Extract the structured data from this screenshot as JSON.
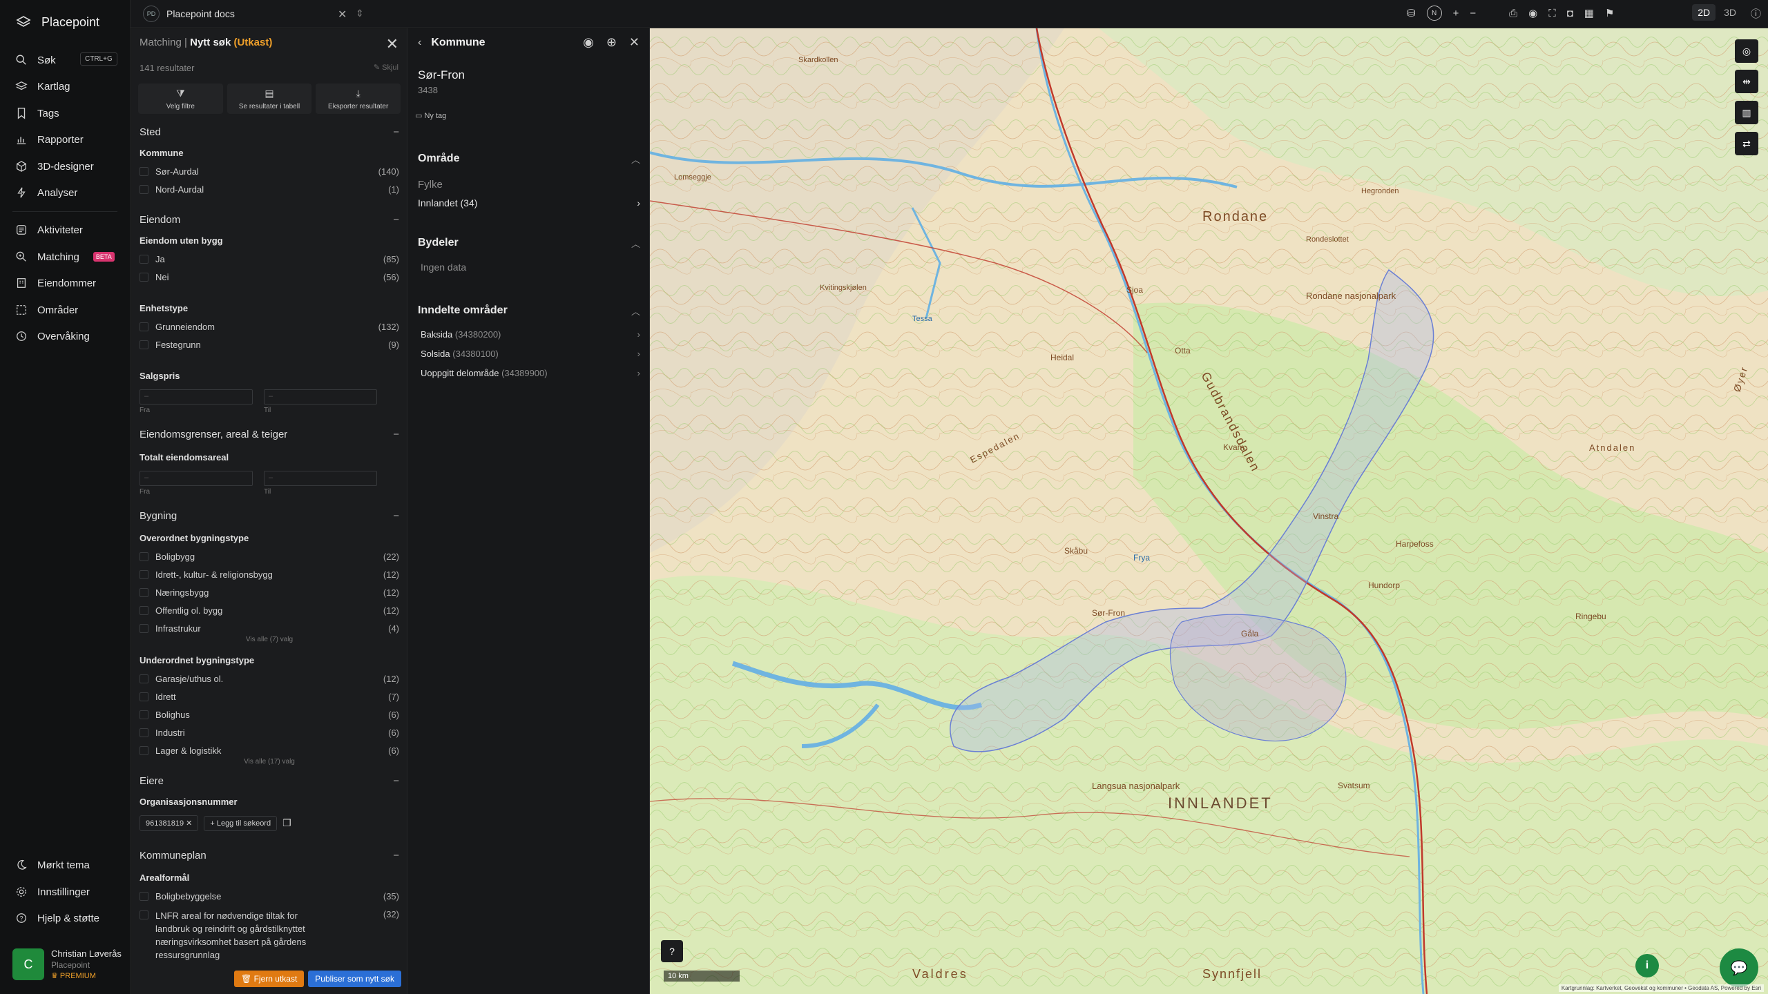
{
  "app": {
    "name": "Placepoint"
  },
  "sidebar": {
    "items": [
      {
        "label": "Søk",
        "icon": "search-icon"
      },
      {
        "label": "Kartlag",
        "icon": "layers-icon"
      },
      {
        "label": "Tags",
        "icon": "bookmark-icon"
      },
      {
        "label": "Rapporter",
        "icon": "chart-icon"
      },
      {
        "label": "3D-designer",
        "icon": "cube-icon"
      },
      {
        "label": "Analyser",
        "icon": "bolt-icon"
      },
      {
        "label": "Aktiviteter",
        "icon": "activity-icon"
      },
      {
        "label": "Matching",
        "icon": "matching-icon",
        "badge": "BETA"
      },
      {
        "label": "Eiendommer",
        "icon": "building-icon"
      },
      {
        "label": "Områder",
        "icon": "area-icon"
      },
      {
        "label": "Overvåking",
        "icon": "clock-icon"
      }
    ],
    "shortcut": "CTRL+G",
    "bottom_items": [
      {
        "label": "Mørkt tema",
        "icon": "moon-icon"
      },
      {
        "label": "Innstillinger",
        "icon": "gear-icon"
      },
      {
        "label": "Hjelp & støtte",
        "icon": "help-icon"
      }
    ],
    "user": {
      "initial": "C",
      "name": "Christian Løverås",
      "company": "Placepoint",
      "plan": "PREMIUM"
    }
  },
  "topbar": {
    "doc_badge": "PD",
    "doc_title": "Placepoint docs",
    "view_2d": "2D",
    "view_3d": "3D"
  },
  "matching": {
    "breadcrumb": "Matching",
    "title": "Nytt søk",
    "status": "(Utkast)",
    "results": "141 resultater",
    "hide": "Skjul",
    "actions": [
      "Velg filtre",
      "Se resultater i tabell",
      "Eksporter resultater"
    ],
    "sections": {
      "sted": "Sted",
      "kommune": "Kommune",
      "eiendom": "Eiendom",
      "uten_bygg": "Eiendom uten bygg",
      "enhetstype": "Enhetstype",
      "salgspris": "Salgspris",
      "grenser": "Eiendomsgrenser, areal & teiger",
      "totalt": "Totalt eiendomsareal",
      "bygning": "Bygning",
      "overordnet": "Overordnet bygningstype",
      "underordnet": "Underordnet bygningstype",
      "eiere": "Eiere",
      "orgnr": "Organisasjonsnummer",
      "kommuneplan": "Kommuneplan",
      "arealformal": "Arealformål"
    },
    "kommune_opts": [
      {
        "label": "Sør-Aurdal",
        "count": "(140)"
      },
      {
        "label": "Nord-Aurdal",
        "count": "(1)"
      }
    ],
    "uten_bygg_opts": [
      {
        "label": "Ja",
        "count": "(85)"
      },
      {
        "label": "Nei",
        "count": "(56)"
      }
    ],
    "enhetstype_opts": [
      {
        "label": "Grunneiendom",
        "count": "(132)"
      },
      {
        "label": "Festegrunn",
        "count": "(9)"
      }
    ],
    "range": {
      "from": "Fra",
      "to": "Til",
      "placeholder": "–"
    },
    "overordnet_opts": [
      {
        "label": "Boligbygg",
        "count": "(22)"
      },
      {
        "label": "Idrett-, kultur- & religionsbygg",
        "count": "(12)"
      },
      {
        "label": "Næringsbygg",
        "count": "(12)"
      },
      {
        "label": "Offentlig ol. bygg",
        "count": "(12)"
      },
      {
        "label": "Infrastrukur",
        "count": "(4)"
      }
    ],
    "overordnet_more": "Vis alle (7) valg",
    "underordnet_opts": [
      {
        "label": "Garasje/uthus ol.",
        "count": "(12)"
      },
      {
        "label": "Idrett",
        "count": "(7)"
      },
      {
        "label": "Bolighus",
        "count": "(6)"
      },
      {
        "label": "Industri",
        "count": "(6)"
      },
      {
        "label": "Lager & logistikk",
        "count": "(6)"
      }
    ],
    "underordnet_more": "Vis alle (17) valg",
    "orgnr_chip": "961381819",
    "add_keyword": "Legg til søkeord",
    "areal_opts": [
      {
        "label": "Boligbebyggelse",
        "count": "(35)"
      },
      {
        "label": "LNFR areal for nødvendige tiltak for landbruk og reindrift og gårdstilknyttet næringsvirksomhet basert på gårdens ressursgrunnlag",
        "count": "(32)"
      }
    ],
    "btn_remove": "Fjern utkast",
    "btn_publish": "Publiser som nytt søk"
  },
  "kommune": {
    "header": "Kommune",
    "name": "Sør-Fron",
    "number": "3438",
    "new_tag": "Ny tag",
    "omrade": "Område",
    "fylke_label": "Fylke",
    "fylke_value": "Innlandet (34)",
    "bydeler": "Bydeler",
    "no_data": "Ingen data",
    "inndelte": "Inndelte områder",
    "areas": [
      {
        "name": "Baksida",
        "code": "(34380200)"
      },
      {
        "name": "Solsida",
        "code": "(34380100)"
      },
      {
        "name": "Uoppgitt delområde",
        "code": "(34389900)"
      }
    ]
  },
  "map": {
    "scale": "10 km",
    "attribution": "Kartgrunnlag: Kartverket, Geovekst og kommuner • Geodata AS, Powered by Esri",
    "labels": [
      "Rondane",
      "Rondane nasjonalpark",
      "Gudbrandsdalen",
      "INNLANDET",
      "Sør-Fron",
      "Hundorp",
      "Harpefoss",
      "Kvam",
      "Vinstra",
      "Ringebu",
      "Langsua nasjonalpark",
      "Synnfjell",
      "Valdres",
      "Lomseggje",
      "Skardkollen",
      "Rondeslottet",
      "Hegronden",
      "Tessa",
      "Kvitingskjølen",
      "Gåla",
      "Espedalen",
      "Skåbu",
      "Heidal",
      "Otta",
      "Sjoa",
      "Frya",
      "Atndalen",
      "Øyer",
      "Svatsum"
    ]
  }
}
